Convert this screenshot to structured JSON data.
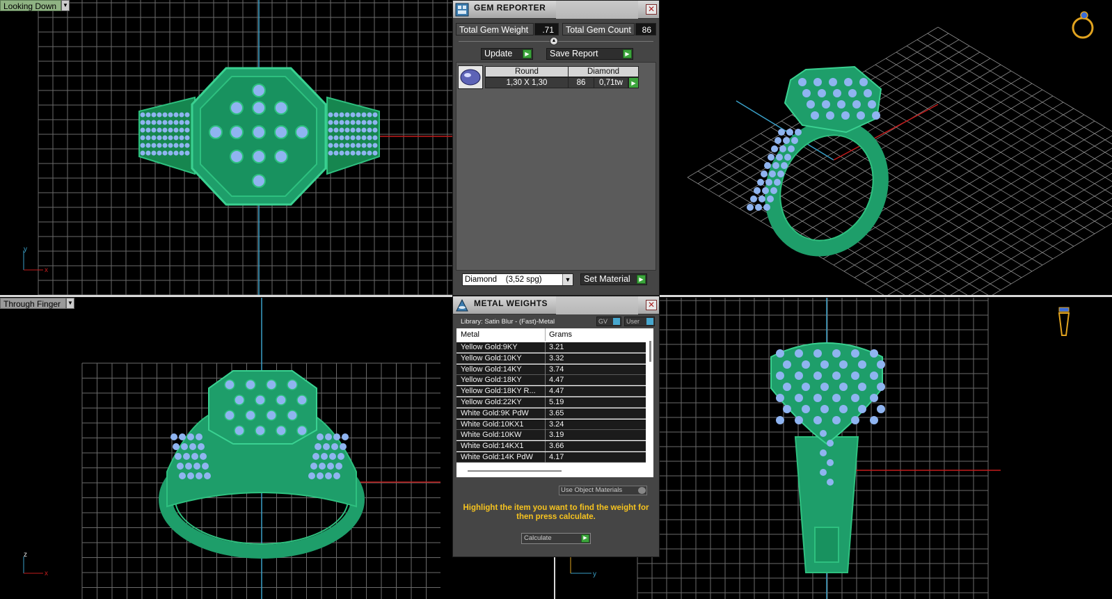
{
  "viewports": {
    "top_left": {
      "label": "Looking Down",
      "axes": {
        "v": "y",
        "h": "x"
      }
    },
    "bottom_left": {
      "label": "Through Finger",
      "axes": {
        "v": "z",
        "h": "x"
      }
    },
    "bottom_right": {
      "axes": {
        "h": "y"
      }
    }
  },
  "gem_reporter": {
    "title": "GEM REPORTER",
    "total_gem_weight_label": "Total Gem Weight",
    "total_gem_weight_value": ".71",
    "total_gem_count_label": "Total Gem Count",
    "total_gem_count_value": "86",
    "update_label": "Update",
    "save_report_label": "Save Report",
    "table": {
      "headers": [
        "Round",
        "Diamond"
      ],
      "row": {
        "size": "1,30 X 1,30",
        "count": "86",
        "weight": "0,71tw"
      }
    },
    "material_select": "Diamond    (3,52 spg)",
    "set_material_label": "Set Material"
  },
  "metal_weights": {
    "title": "METAL WEIGHTS",
    "library": "Library: Satin Blur - (Fast)-Metal",
    "toggle_gv": "GV",
    "toggle_user": "User",
    "headers": {
      "metal": "Metal",
      "grams": "Grams"
    },
    "rows": [
      {
        "metal": "Yellow Gold:9KY",
        "grams": "3.21"
      },
      {
        "metal": "Yellow Gold:10KY",
        "grams": "3.32"
      },
      {
        "metal": "Yellow Gold:14KY",
        "grams": "3.74"
      },
      {
        "metal": "Yellow Gold:18KY",
        "grams": "4.47"
      },
      {
        "metal": "Yellow Gold:18KY R...",
        "grams": "4.47"
      },
      {
        "metal": "Yellow Gold:22KY",
        "grams": "5.19"
      },
      {
        "metal": "White Gold:9K PdW",
        "grams": "3.65"
      },
      {
        "metal": "White Gold:10KX1",
        "grams": "3.24"
      },
      {
        "metal": "White Gold:10KW",
        "grams": "3.19"
      },
      {
        "metal": "White Gold:14KX1",
        "grams": "3.66"
      },
      {
        "metal": "White Gold:14K PdW",
        "grams": "4.17"
      }
    ],
    "use_object_materials": "Use Object Materials",
    "hint": "Highlight the item you want to find the weight for then press calculate.",
    "calculate_label": "Calculate"
  },
  "colors": {
    "ring_green": "#1e9e6a",
    "gem_blue": "#8fb4f0",
    "grid": "#6b6b6b",
    "axis_red": "#c41c1c",
    "axis_blue": "#3aa0c8",
    "go_green": "#3ca53c",
    "hint_yellow": "#f6c31f"
  }
}
